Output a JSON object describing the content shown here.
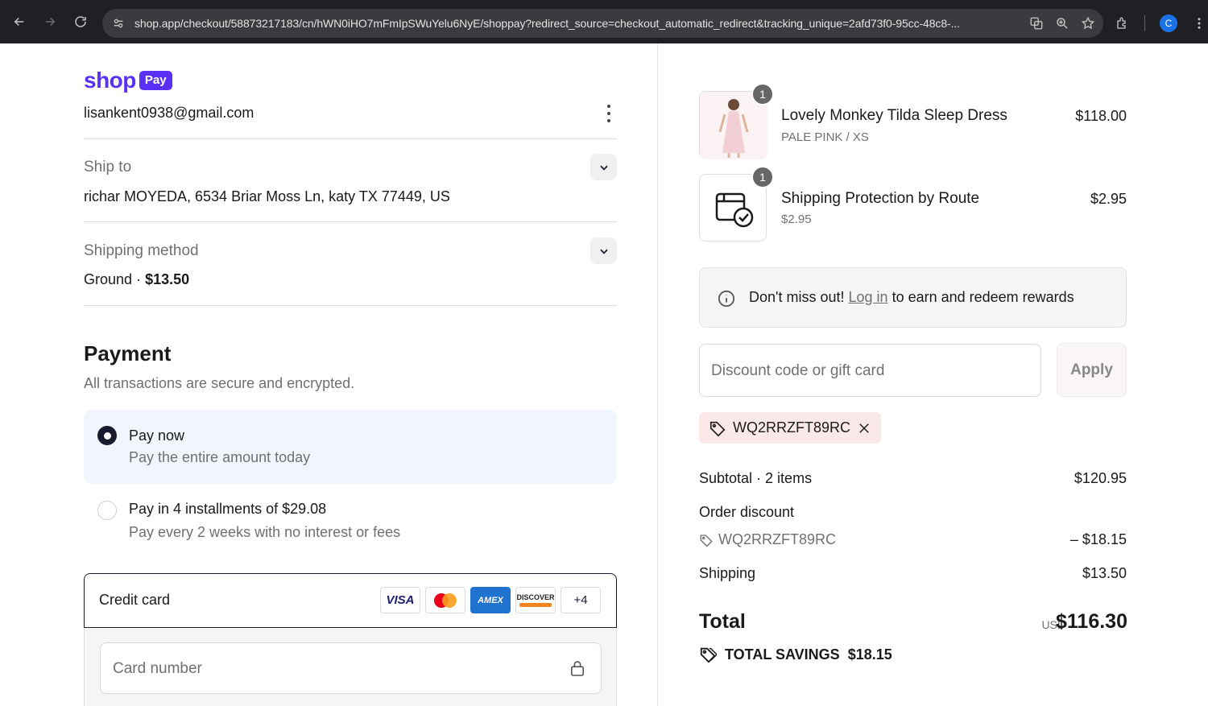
{
  "browser": {
    "url": "shop.app/checkout/58873217183/cn/hWN0iHO7mFmIpSWuYelu6NyE/shoppay?redirect_source=checkout_automatic_redirect&tracking_unique=2afd73f0-95cc-48c8-...",
    "profile_initial": "C"
  },
  "brand": {
    "shop": "shop",
    "pay": "Pay",
    "color": "#5a31f4"
  },
  "account": {
    "email": "lisankent0938@gmail.com"
  },
  "ship_to": {
    "label": "Ship to",
    "value": "richar MOYEDA, 6534 Briar Moss Ln, katy TX 77449, US"
  },
  "shipping_method": {
    "label": "Shipping method",
    "name": "Ground",
    "separator": "·",
    "price": "$13.50"
  },
  "payment": {
    "title": "Payment",
    "subtitle": "All transactions are secure and encrypted.",
    "options": [
      {
        "title": "Pay now",
        "desc": "Pay the entire amount today",
        "selected": true
      },
      {
        "title": "Pay in 4 installments of $29.08",
        "desc": "Pay every 2 weeks with no interest or fees",
        "selected": false
      }
    ],
    "credit_card": {
      "label": "Credit card",
      "brands": [
        "VISA",
        "AMEX",
        "DISCOVER"
      ],
      "more": "+4",
      "card_number_placeholder": "Card number"
    }
  },
  "order": {
    "items": [
      {
        "name": "Lovely Monkey Tilda Sleep Dress",
        "variant": "PALE PINK / XS",
        "price": "$118.00",
        "qty": "1"
      },
      {
        "name": "Shipping Protection by Route",
        "variant": "$2.95",
        "price": "$2.95",
        "qty": "1"
      }
    ],
    "notice": {
      "prefix": "Don't miss out!",
      "link": "Log in",
      "suffix": "to earn and redeem rewards"
    },
    "discount_placeholder": "Discount code or gift card",
    "apply_label": "Apply",
    "applied_code": "WQ2RRZFT89RC",
    "subtotal_label": "Subtotal · 2 items",
    "subtotal": "$120.95",
    "discount_label": "Order discount",
    "discount_code": "WQ2RRZFT89RC",
    "discount_amount": "– $18.15",
    "shipping_label": "Shipping",
    "shipping": "$13.50",
    "total_label": "Total",
    "currency": "USD",
    "total": "$116.30",
    "savings_label": "TOTAL SAVINGS",
    "savings": "$18.15"
  }
}
